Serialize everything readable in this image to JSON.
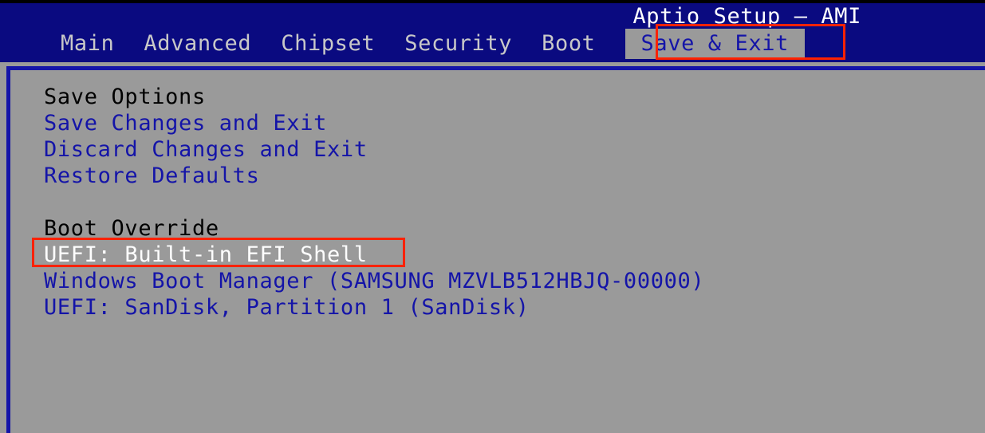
{
  "app": {
    "title": "Aptio Setup – AMI"
  },
  "menubar": {
    "tabs": [
      {
        "label": "Main",
        "selected": false
      },
      {
        "label": "Advanced",
        "selected": false
      },
      {
        "label": "Chipset",
        "selected": false
      },
      {
        "label": "Security",
        "selected": false
      },
      {
        "label": "Boot",
        "selected": false
      },
      {
        "label": "Save & Exit",
        "selected": true
      }
    ],
    "selected_tab": "Save & Exit"
  },
  "main": {
    "sections": [
      {
        "heading": "Save Options",
        "items": [
          {
            "label": "Save Changes and Exit",
            "highlighted": false
          },
          {
            "label": "Discard Changes and Exit",
            "highlighted": false
          },
          {
            "label": "Restore Defaults",
            "highlighted": false
          }
        ]
      },
      {
        "heading": "Boot Override",
        "items": [
          {
            "label": "UEFI: Built-in EFI Shell",
            "highlighted": true
          },
          {
            "label": "Windows Boot Manager (SAMSUNG MZVLB512HBJQ-00000)",
            "highlighted": false
          },
          {
            "label": "UEFI: SanDisk, Partition 1 (SanDisk)",
            "highlighted": false
          }
        ]
      }
    ]
  },
  "annotations": [
    {
      "name": "save-and-exit-tab-highlight",
      "target": "Save & Exit"
    },
    {
      "name": "efi-shell-entry-highlight",
      "target": "UEFI: Built-in EFI Shell"
    }
  ],
  "colors": {
    "header_blue": "#0a0a80",
    "panel_gray": "#9a9a9a",
    "item_blue": "#1414a8",
    "heading_black": "#000000",
    "selected_white": "#ffffff",
    "annotation_red": "#ff2200",
    "tab_text": "#c8c8c8"
  }
}
